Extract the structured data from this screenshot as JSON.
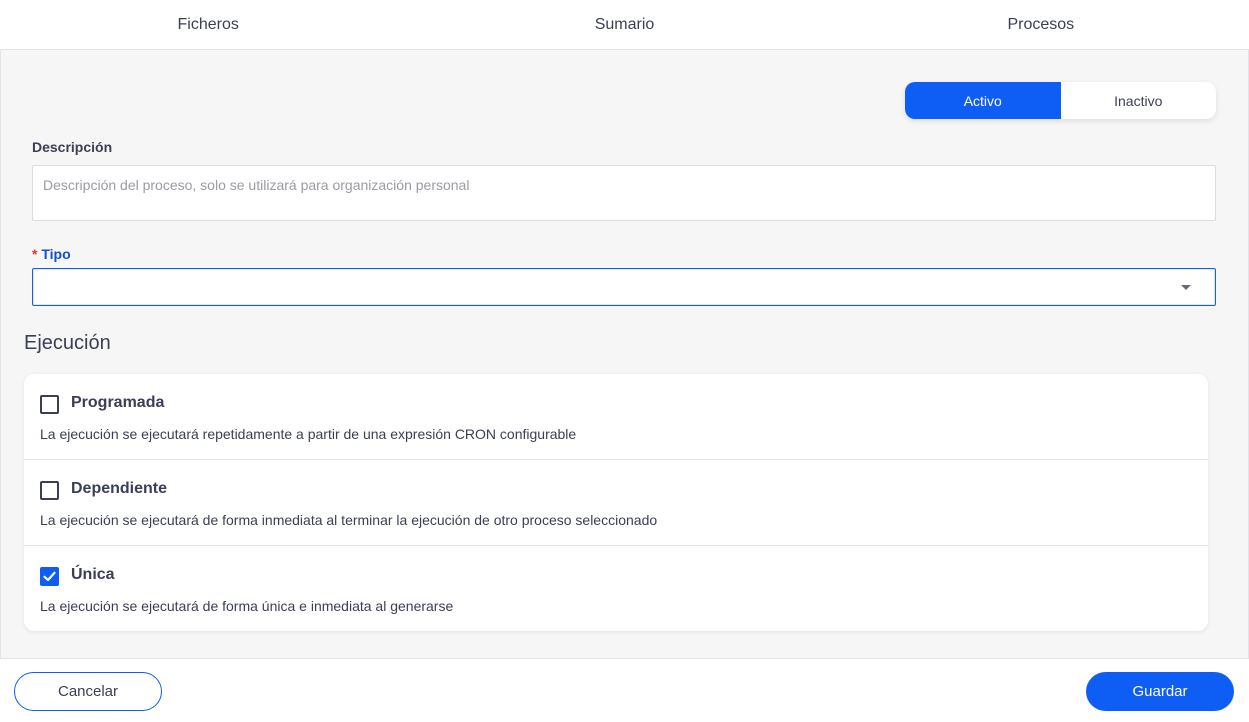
{
  "tabs": [
    {
      "label": "Ficheros"
    },
    {
      "label": "Sumario"
    },
    {
      "label": "Procesos"
    }
  ],
  "status_toggle": {
    "active_label": "Activo",
    "inactive_label": "Inactivo",
    "selected": "Activo"
  },
  "description": {
    "label": "Descripción",
    "value": "",
    "placeholder": "Descripción del proceso, solo se utilizará para organización personal"
  },
  "tipo": {
    "required_mark": "*",
    "label": "Tipo",
    "value": ""
  },
  "execution": {
    "title": "Ejecución",
    "options": [
      {
        "title": "Programada",
        "description": "La ejecución se ejecutará repetidamente a partir de una expresión CRON configurable",
        "checked": false
      },
      {
        "title": "Dependiente",
        "description": "La ejecución se ejecutará de forma inmediata al terminar la ejecución de otro proceso seleccionado",
        "checked": false
      },
      {
        "title": "Única",
        "description": "La ejecución se ejecutará de forma única e inmediata al generarse",
        "checked": true
      }
    ]
  },
  "footer": {
    "cancel_label": "Cancelar",
    "save_label": "Guardar"
  },
  "colors": {
    "primary": "#0e5ef5",
    "required": "#e5322d"
  }
}
